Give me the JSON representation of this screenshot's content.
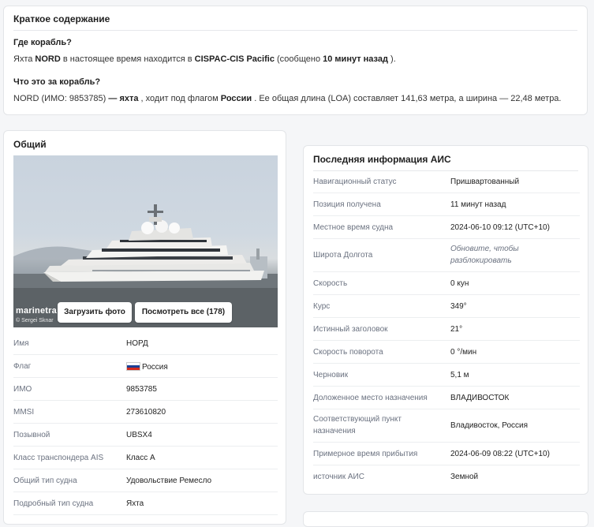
{
  "summary": {
    "title": "Краткое содержание",
    "q1": "Где корабль?",
    "a1_pre": "Яхта ",
    "a1_name": "NORD",
    "a1_mid": " в настоящее время находится в ",
    "a1_area": "CISPAC-CIS Pacific",
    "a1_post1": " (сообщено ",
    "a1_ago": "10 минут назад",
    "a1_post2": " ).",
    "q2": "Что это за корабль?",
    "a2_pre": "NORD (ИМО: 9853785) ",
    "a2_dash": "—",
    "a2_type": " яхта",
    "a2_mid": " , ходит под флагом ",
    "a2_flag": "России",
    "a2_post": " . Ее общая длина (LOA) составляет 141,63 метра, а ширина — 22,48 метра."
  },
  "general": {
    "title": "Общий",
    "photo": {
      "watermark": "marinetra",
      "credit": "© Sergei Sknar",
      "upload_label": "Загрузить фото",
      "view_all_label": "Посмотреть все (178)"
    },
    "rows": [
      {
        "k": "Имя",
        "v": "НОРД"
      },
      {
        "k": "Флаг",
        "v": "Россия",
        "flag": true
      },
      {
        "k": "ИМО",
        "v": "9853785"
      },
      {
        "k": "MMSI",
        "v": "273610820"
      },
      {
        "k": "Позывной",
        "v": "UBSX4"
      },
      {
        "k": "Класс транспондера AIS",
        "v": "Класс А"
      },
      {
        "k": "Общий тип судна",
        "v": "Удовольствие Ремесло"
      },
      {
        "k": "Подробный тип судна",
        "v": "Яхта"
      }
    ]
  },
  "ais": {
    "title": "Последняя информация АИС",
    "rows": [
      {
        "k": "Навигационный статус",
        "v": "Пришвартованный"
      },
      {
        "k": "Позиция получена",
        "v": "11 минут назад"
      },
      {
        "k": "Местное время судна",
        "v": "2024-06-10 09:12 (UTC+10)"
      },
      {
        "k": "Широта Долгота",
        "v": "Обновите, чтобы разблокировать",
        "link": true
      },
      {
        "k": "Скорость",
        "v": "0 кун"
      },
      {
        "k": "Курс",
        "v": "349°"
      },
      {
        "k": "Истинный заголовок",
        "v": "21°"
      },
      {
        "k": "Скорость поворота",
        "v": "0 °/мин"
      },
      {
        "k": "Черновик",
        "v": "5,1 м"
      },
      {
        "k": "Доложенное место назначения",
        "v": "ВЛАДИВОСТОК"
      },
      {
        "k": "Соответствующий пункт назначения",
        "v": "Владивосток, Россия"
      },
      {
        "k": "Примерное время прибытия",
        "v": "2024-06-09 08:22 (UTC+10)"
      },
      {
        "k": "источник АИС",
        "v": "Земной"
      }
    ]
  },
  "colors": {
    "flag_white": "#ffffff",
    "flag_blue": "#1c3f94",
    "flag_red": "#d52b1e"
  }
}
